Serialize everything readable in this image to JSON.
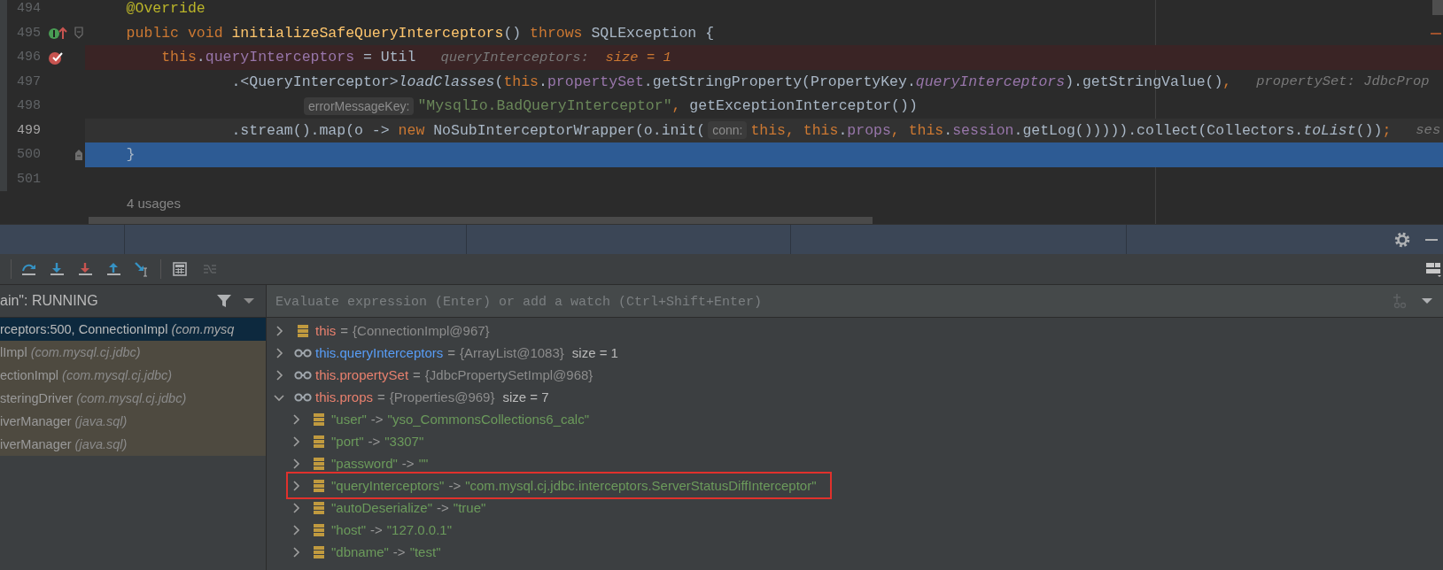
{
  "editor": {
    "lines": [
      {
        "number": "494",
        "kind": "code",
        "breakpoint": false,
        "current": false,
        "selected": false,
        "implemented": false,
        "fold_start": false,
        "fold_end": false,
        "tokens": [
          {
            "text": "    @Override",
            "kind": "annotation"
          }
        ]
      },
      {
        "number": "495",
        "kind": "code",
        "breakpoint": false,
        "current": false,
        "selected": false,
        "implemented": true,
        "fold_start": true,
        "fold_end": false,
        "tokens": [
          {
            "text": "    public void ",
            "kind": "keyword"
          },
          {
            "text": "initializeSafeQueryInterceptors",
            "kind": "method_decl"
          },
          {
            "text": "() ",
            "kind": "plain"
          },
          {
            "text": "throws",
            "kind": "keyword"
          },
          {
            "text": " SQLException {",
            "kind": "plain"
          }
        ]
      },
      {
        "number": "496",
        "kind": "code",
        "breakpoint": true,
        "current": false,
        "selected": false,
        "implemented": false,
        "fold_start": false,
        "fold_end": false,
        "tokens": [
          {
            "text": "        this",
            "kind": "keyword"
          },
          {
            "text": ".",
            "kind": "plain"
          },
          {
            "text": "queryInterceptors",
            "kind": "field"
          },
          {
            "text": " = Util",
            "kind": "plain"
          },
          {
            "text": "queryInterceptors: ",
            "kind": "hint"
          },
          {
            "text": " size = 1",
            "kind": "hint_value"
          }
        ]
      },
      {
        "number": "497",
        "kind": "code",
        "breakpoint": false,
        "current": false,
        "selected": false,
        "implemented": false,
        "fold_start": false,
        "fold_end": false,
        "tokens": [
          {
            "text": "                .<QueryInterceptor>",
            "kind": "plain"
          },
          {
            "text": "loadClasses",
            "kind": "method_italic"
          },
          {
            "text": "(",
            "kind": "plain"
          },
          {
            "text": "this",
            "kind": "keyword"
          },
          {
            "text": ".",
            "kind": "plain"
          },
          {
            "text": "propertySet",
            "kind": "field"
          },
          {
            "text": ".getStringProperty(PropertyKey.",
            "kind": "plain"
          },
          {
            "text": "queryInterceptors",
            "kind": "field_italic"
          },
          {
            "text": ").getStringValue()",
            "kind": "plain"
          },
          {
            "text": ",",
            "kind": "keyword"
          },
          {
            "text": "propertySet: JdbcProp",
            "kind": "hint"
          }
        ]
      },
      {
        "number": "498",
        "kind": "continuation",
        "breakpoint": false,
        "current": false,
        "selected": false,
        "implemented": false,
        "fold_start": false,
        "fold_end": false,
        "tokens": [
          {
            "text": "errorMessageKey:",
            "kind": "param_hint"
          },
          {
            "text": "\"MysqlIo.BadQueryInterceptor\"",
            "kind": "string"
          },
          {
            "text": ",",
            "kind": "keyword"
          },
          {
            "text": " getExceptionInterceptor())",
            "kind": "plain"
          }
        ]
      },
      {
        "number": "499",
        "kind": "code",
        "breakpoint": false,
        "current": true,
        "selected": false,
        "implemented": false,
        "fold_start": false,
        "fold_end": false,
        "tokens": [
          {
            "text": "                .stream().map(o -> ",
            "kind": "plain"
          },
          {
            "text": "new",
            "kind": "keyword"
          },
          {
            "text": " NoSubInterceptorWrapper(o.init(",
            "kind": "plain"
          },
          {
            "text": "conn:",
            "kind": "param_hint"
          },
          {
            "text": "this, this",
            "kind": "keyword"
          },
          {
            "text": ".",
            "kind": "plain"
          },
          {
            "text": "props",
            "kind": "field"
          },
          {
            "text": ", this",
            "kind": "keyword"
          },
          {
            "text": ".",
            "kind": "plain"
          },
          {
            "text": "session",
            "kind": "field"
          },
          {
            "text": ".getLog())))).collect(Collectors.",
            "kind": "plain"
          },
          {
            "text": "toList",
            "kind": "method_italic"
          },
          {
            "text": "())",
            "kind": "plain"
          },
          {
            "text": ";",
            "kind": "keyword"
          },
          {
            "text": "ses",
            "kind": "hint"
          }
        ]
      },
      {
        "number": "500",
        "kind": "code",
        "breakpoint": false,
        "current": false,
        "selected": true,
        "implemented": false,
        "fold_start": false,
        "fold_end": true,
        "tokens": [
          {
            "text": "    }",
            "kind": "plain"
          }
        ]
      },
      {
        "number": "501",
        "kind": "code",
        "breakpoint": false,
        "current": false,
        "selected": false,
        "implemented": false,
        "fold_start": false,
        "fold_end": false
      }
    ],
    "usages": "4 usages"
  },
  "debugger": {
    "thread": "ain\": RUNNING",
    "frames": [
      {
        "method": "rceptors:500, ConnectionImpl",
        "location": "(com.mysq",
        "selected": true
      },
      {
        "method": "lImpl",
        "location": "(com.mysql.cj.jdbc)",
        "selected": false
      },
      {
        "method": "ectionImpl",
        "location": "(com.mysql.cj.jdbc)",
        "selected": false
      },
      {
        "method": "steringDriver",
        "location": "(com.mysql.cj.jdbc)",
        "selected": false
      },
      {
        "method": "iverManager",
        "location": "(java.sql)",
        "selected": false
      },
      {
        "method": "iverManager",
        "location": "(java.sql)",
        "selected": false
      }
    ],
    "evaluate_placeholder": "Evaluate expression (Enter) or add a watch (Ctrl+Shift+Enter)",
    "variables": [
      {
        "kind": "field",
        "name": "this",
        "op": "=",
        "value": "{ConnectionImpl@967}",
        "expanded": false,
        "changed": false
      },
      {
        "kind": "watch",
        "name": "this.queryInterceptors",
        "op": "=",
        "value": "{ArrayList@1083}",
        "extra": "size = 1",
        "expanded": false,
        "changed": true
      },
      {
        "kind": "watch",
        "name": "this.propertySet",
        "op": "=",
        "value": "{JdbcPropertySetImpl@968}",
        "expanded": false,
        "changed": false
      },
      {
        "kind": "watch",
        "name": "this.props",
        "op": "=",
        "value": "{Properties@969}",
        "extra": "size = 7",
        "expanded": true,
        "changed": false,
        "children": [
          {
            "kind": "field",
            "name": "\"user\"",
            "op": "->",
            "value": "\"yso_CommonsCollections6_calc\"",
            "expanded": false,
            "highlighted": false
          },
          {
            "kind": "field",
            "name": "\"port\"",
            "op": "->",
            "value": "\"3307\"",
            "expanded": false,
            "highlighted": false
          },
          {
            "kind": "field",
            "name": "\"password\"",
            "op": "->",
            "value": "\"\"",
            "expanded": false,
            "highlighted": false
          },
          {
            "kind": "field",
            "name": "\"queryInterceptors\"",
            "op": "->",
            "value": "\"com.mysql.cj.jdbc.interceptors.ServerStatusDiffInterceptor\"",
            "expanded": false,
            "highlighted": true
          },
          {
            "kind": "field",
            "name": "\"autoDeserialize\"",
            "op": "->",
            "value": "\"true\"",
            "expanded": false,
            "highlighted": false
          },
          {
            "kind": "field",
            "name": "\"host\"",
            "op": "->",
            "value": "\"127.0.0.1\"",
            "expanded": false,
            "highlighted": false
          },
          {
            "kind": "field",
            "name": "\"dbname\"",
            "op": "->",
            "value": "\"test\"",
            "expanded": false,
            "highlighted": false
          }
        ]
      }
    ]
  }
}
